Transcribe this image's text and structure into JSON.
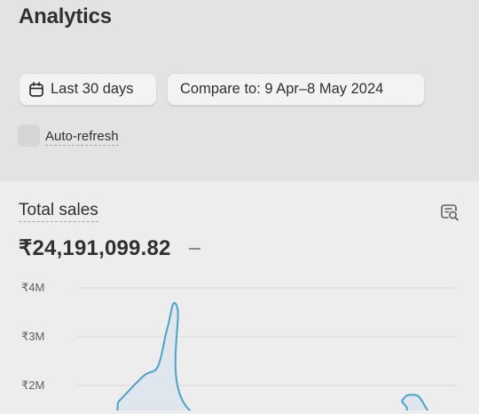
{
  "page": {
    "title": "Analytics"
  },
  "filters": {
    "date_range_label": "Last 30 days",
    "compare_label": "Compare to: 9 Apr–8 May 2024"
  },
  "auto_refresh": {
    "label": "Auto-refresh",
    "checked": false
  },
  "card": {
    "title": "Total sales",
    "value": "₹24,191,099.82",
    "comparison_placeholder": "–"
  },
  "icons": {
    "date": "calendar-icon",
    "explore": "explore-data-icon"
  },
  "colors": {
    "line": "#4aa3c8",
    "fill": "#dfe6ed",
    "gridline": "#dadadb"
  },
  "chart_data": {
    "type": "line",
    "title": "",
    "yticks": [
      "₹4M",
      "₹3M",
      "₹2M"
    ],
    "ylim": [
      2000000,
      4000000
    ],
    "grid": true,
    "series": [
      {
        "x": [
          0.0,
          0.22,
          0.25,
          0.3,
          0.33,
          0.35,
          0.37,
          0.41,
          0.81,
          0.84,
          0.85,
          0.87,
          0.88,
          0.9,
          0.92
        ],
        "values": [
          1400000,
          1400000,
          1700000,
          2200000,
          2400000,
          3200000,
          3600000,
          1400000,
          1400000,
          1700000,
          1800000,
          1800000,
          1700000,
          1400000,
          1400000
        ]
      }
    ]
  }
}
